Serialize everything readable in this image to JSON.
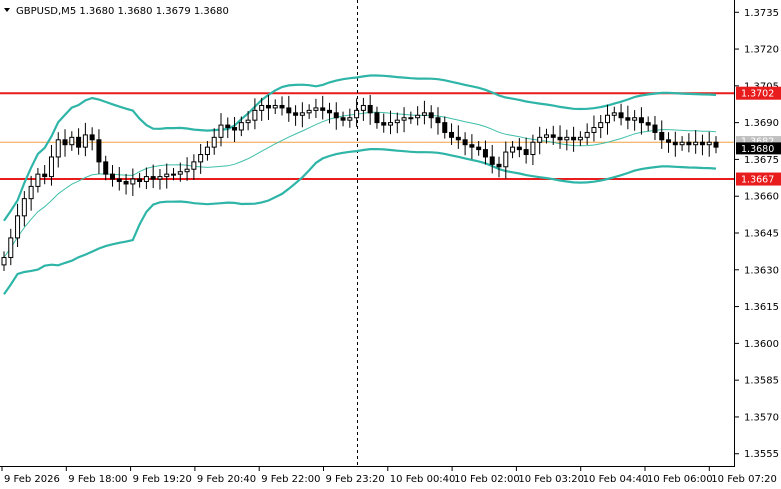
{
  "header": {
    "symbol_text": "GBPUSD,M5  1.3680 1.3680 1.3679 1.3680"
  },
  "colors": {
    "background": "#ffffff",
    "candle": "#000000",
    "bollinger": "#2fb5a8",
    "moving_average": "#3fbfaa",
    "resistance": "#e81c1c",
    "support": "#e81c1c",
    "last_price_line": "#f0a040",
    "vertical_marker": "#000000"
  },
  "chart_data": {
    "type": "candlestick",
    "symbol": "GBPUSD",
    "timeframe": "M5",
    "ohlc_header": {
      "open": 1.368,
      "high": 1.368,
      "low": 1.3679,
      "close": 1.368
    },
    "ylim": [
      1.355,
      1.374
    ],
    "y_ticks": [
      "1.3735",
      "1.3720",
      "1.3705",
      "1.3690",
      "1.3675",
      "1.3660",
      "1.3645",
      "1.3630",
      "1.3615",
      "1.3600",
      "1.3585",
      "1.3570",
      "1.3555"
    ],
    "x_ticks": [
      "9 Feb 2026",
      "9 Feb 18:00",
      "9 Feb 19:20",
      "9 Feb 20:40",
      "9 Feb 22:00",
      "9 Feb 23:20",
      "10 Feb 00:40",
      "10 Feb 02:00",
      "10 Feb 03:20",
      "10 Feb 04:40",
      "10 Feb 06:00",
      "10 Feb 07:20"
    ],
    "price_labels": {
      "resistance": "1.3702",
      "bid_partial": "1.3682",
      "last": "1.3680",
      "support": "1.3667"
    },
    "levels": {
      "resistance": 1.3702,
      "support": 1.3667,
      "last": 1.3682
    },
    "vertical_line_at_time": "9 Feb 23:20",
    "closes": [
      1.3635,
      1.3643,
      1.3652,
      1.3659,
      1.3664,
      1.3669,
      1.3668,
      1.3676,
      1.3683,
      1.3681,
      1.3684,
      1.368,
      1.3685,
      1.3683,
      1.3674,
      1.3669,
      1.3667,
      1.3666,
      1.3665,
      1.3667,
      1.3666,
      1.3668,
      1.3667,
      1.3668,
      1.3669,
      1.3669,
      1.367,
      1.3671,
      1.3674,
      1.3677,
      1.368,
      1.3684,
      1.3689,
      1.3688,
      1.3687,
      1.369,
      1.3691,
      1.3695,
      1.3697,
      1.3696,
      1.3697,
      1.3696,
      1.3694,
      1.3693,
      1.3694,
      1.3695,
      1.3696,
      1.3695,
      1.3694,
      1.3692,
      1.3691,
      1.3692,
      1.3695,
      1.3697,
      1.3694,
      1.369,
      1.3689,
      1.369,
      1.3691,
      1.3692,
      1.3692,
      1.3693,
      1.3694,
      1.3692,
      1.369,
      1.3686,
      1.3684,
      1.3683,
      1.3681,
      1.368,
      1.3679,
      1.3676,
      1.3673,
      1.3672,
      1.3678,
      1.368,
      1.3679,
      1.3677,
      1.3682,
      1.3684,
      1.3685,
      1.3684,
      1.3683,
      1.3684,
      1.3683,
      1.3684,
      1.3686,
      1.3688,
      1.369,
      1.3693,
      1.3694,
      1.3692,
      1.3691,
      1.3692,
      1.369,
      1.3689,
      1.3686,
      1.3683,
      1.3682,
      1.3681,
      1.3682,
      1.3681,
      1.3682,
      1.3681,
      1.3682,
      1.368
    ]
  }
}
